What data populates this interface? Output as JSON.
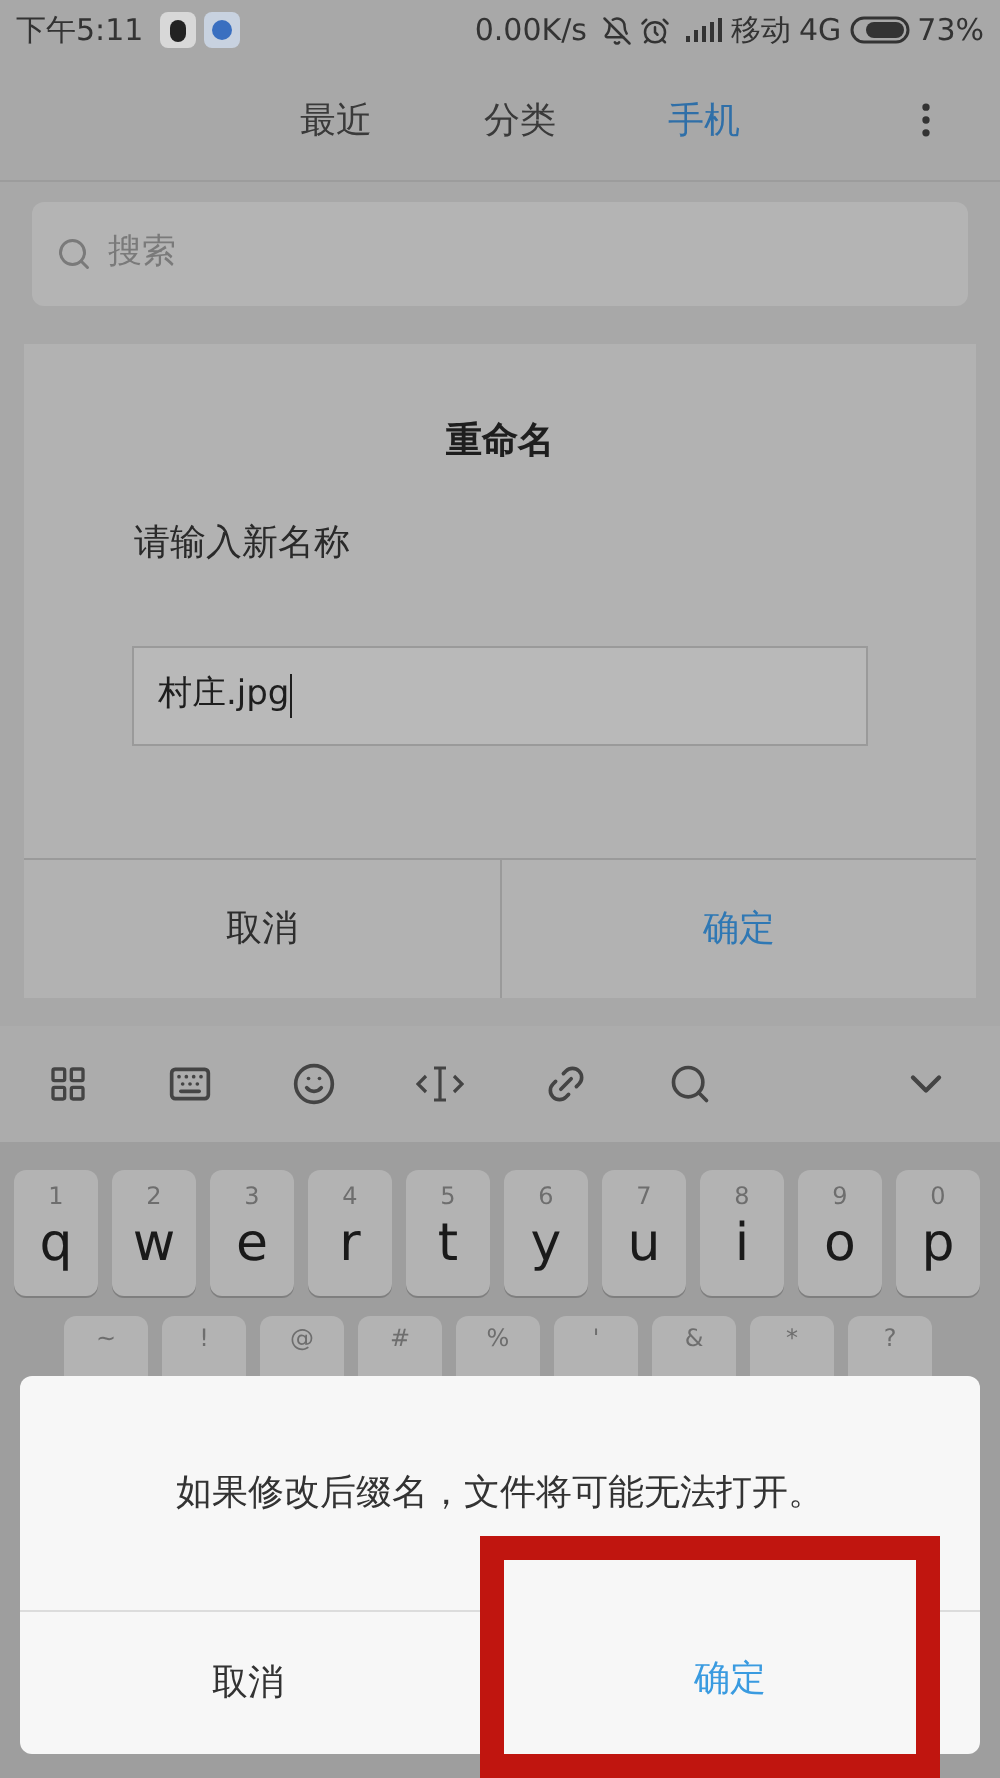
{
  "status_bar": {
    "time": "下午5:11",
    "speed": "0.00K/s",
    "carrier": "移动",
    "network": "4G",
    "battery_text": "73%"
  },
  "tabs": [
    {
      "label": "最近",
      "selected": false
    },
    {
      "label": "分类",
      "selected": false
    },
    {
      "label": "手机",
      "selected": true
    }
  ],
  "search": {
    "placeholder": "搜索"
  },
  "rename_dialog": {
    "title": "重命名",
    "prompt": "请输入新名称",
    "value": "村庄.jpg",
    "buttons": [
      {
        "label": "取消",
        "kind": "cancel"
      },
      {
        "label": "确定",
        "kind": "confirm"
      }
    ]
  },
  "keyboard": {
    "row_1": [
      {
        "number": "1",
        "letter": "q"
      },
      {
        "number": "2",
        "letter": "w"
      },
      {
        "number": "3",
        "letter": "e"
      },
      {
        "number": "4",
        "letter": "r"
      },
      {
        "number": "5",
        "letter": "t"
      },
      {
        "number": "6",
        "letter": "y"
      },
      {
        "number": "7",
        "letter": "u"
      },
      {
        "number": "8",
        "letter": "i"
      },
      {
        "number": "9",
        "letter": "o"
      },
      {
        "number": "0",
        "letter": "p"
      }
    ],
    "row_2_symbols": [
      "~",
      "!",
      "@",
      "#",
      "%",
      "'",
      "&",
      "*",
      "?"
    ]
  },
  "warning_dialog": {
    "message": "如果修改后缀名，文件将可能无法打开。",
    "buttons": [
      {
        "label": "取消",
        "kind": "cancel"
      },
      {
        "label": "确定",
        "kind": "confirm"
      }
    ]
  }
}
